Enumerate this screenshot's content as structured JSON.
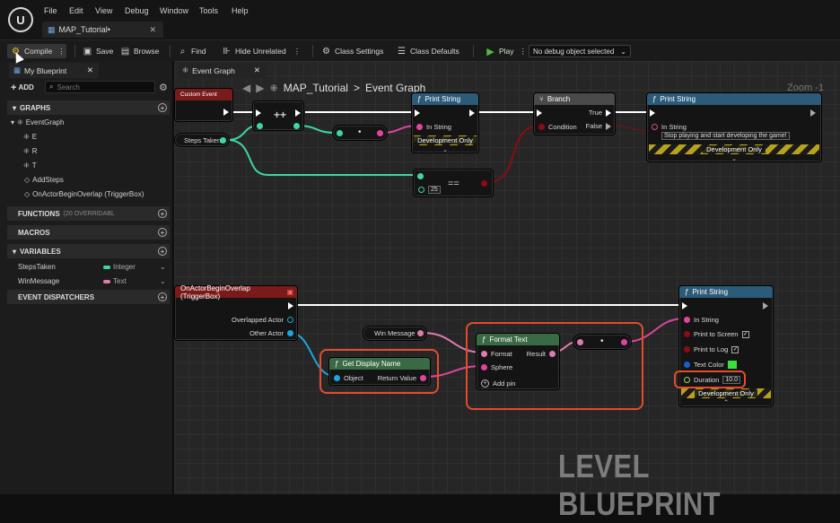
{
  "app": {
    "logo": "U"
  },
  "menu": [
    "File",
    "Edit",
    "View",
    "Debug",
    "Window",
    "Tools",
    "Help"
  ],
  "doc_tab": {
    "label": "MAP_Tutorial•"
  },
  "toolbar": {
    "compile": "Compile",
    "save": "Save",
    "browse": "Browse",
    "find": "Find",
    "hide_unrelated": "Hide Unrelated",
    "class_settings": "Class Settings",
    "class_defaults": "Class Defaults",
    "play": "Play",
    "debug_object": "No debug object selected"
  },
  "left_panel": {
    "tab": "My Blueprint",
    "add": "ADD",
    "search_placeholder": "Search",
    "graphs_header": "GRAPHS",
    "event_graph": "EventGraph",
    "graph_items": [
      "E",
      "R",
      "T",
      "AddSteps",
      "OnActorBeginOverlap (TriggerBox)"
    ],
    "functions_header": "FUNCTIONS",
    "functions_sub": "(20 OVERRIDABL",
    "macros_header": "MACROS",
    "variables_header": "VARIABLES",
    "variables": [
      {
        "name": "StepsTaken",
        "type": "Integer",
        "color": "#3fd6a0"
      },
      {
        "name": "WinMessage",
        "type": "Text",
        "color": "#e07aae"
      }
    ],
    "dispatchers_header": "EVENT DISPATCHERS"
  },
  "graph": {
    "tab": "Event Graph",
    "breadcrumb_root": "MAP_Tutorial",
    "breadcrumb_sep": ">",
    "breadcrumb_leaf": "Event Graph",
    "zoom": "Zoom -1",
    "watermark": "LEVEL BLUEPRINT"
  },
  "nodes": {
    "custom_event": "Custom Event",
    "steps_taken": "Steps Taken",
    "add_op": "++",
    "mult_op": "•",
    "print1_title": "Print String",
    "in_string": "In String",
    "development_only": "Development Only",
    "branch_title": "Branch",
    "condition": "Condition",
    "true": "True",
    "false": "False",
    "print2_title": "Print String",
    "print2_default": "Stop playing and start developing the game!",
    "eq_op": "==",
    "eq_value": "25",
    "overlap_title": "OnActorBeginOverlap (TriggerBox)",
    "overlapped_actor": "Overlapped Actor",
    "other_actor": "Other Actor",
    "win_message": "Win Message",
    "get_display_name": "Get Display Name",
    "object": "Object",
    "return_value": "Return Value",
    "format_text": "Format Text",
    "format": "Format",
    "result": "Result",
    "sphere": "Sphere",
    "add_pin": "Add pin",
    "print3_title": "Print String",
    "print_to_screen": "Print to Screen",
    "print_to_log": "Print to Log",
    "text_color": "Text Color",
    "duration": "Duration",
    "duration_value": "10.0",
    "check": "✓"
  },
  "colors": {
    "exec": "#ffffff",
    "integer": "#3fd6a0",
    "string": "#e0449e",
    "text": "#e07aae",
    "bool": "#8c0b14",
    "object": "#1aa7e0",
    "highlight": "#e64b2d",
    "function_head": "#2c5b7a",
    "event_head": "#7a1b1b",
    "pure_head": "#3a6a45"
  }
}
